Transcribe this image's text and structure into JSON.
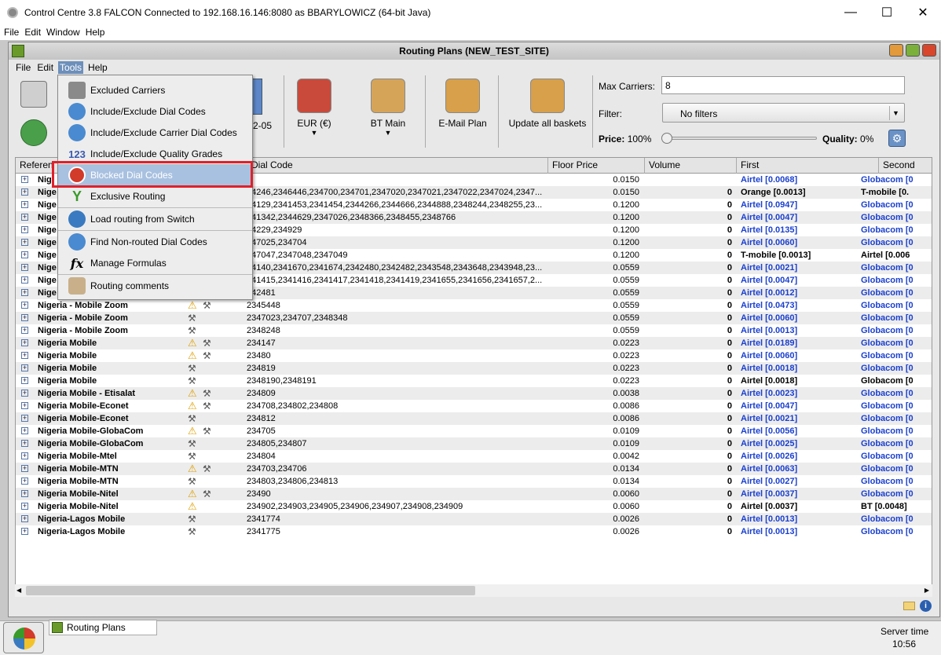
{
  "window": {
    "title": "Control Centre 3.8 FALCON Connected to 192.168.16.146:8080 as BBARYLOWICZ (64-bit Java)"
  },
  "top_menu": [
    "File",
    "Edit",
    "Window",
    "Help"
  ],
  "frame": {
    "title": "Routing Plans (NEW_TEST_SITE)"
  },
  "frame_menu": [
    "File",
    "Edit",
    "Tools",
    "Help"
  ],
  "toolbar": {
    "date_suffix": "2-05",
    "currency": "EUR (€)",
    "bt_main": "BT Main",
    "email_plan": "E-Mail Plan",
    "update_baskets": "Update all baskets"
  },
  "filters": {
    "max_carriers_label": "Max Carriers:",
    "max_carriers_value": "8",
    "filter_label": "Filter:",
    "filter_value": "No filters",
    "price_label": "Price:",
    "price_value": "100%",
    "quality_label": "Quality:",
    "quality_value": "0%",
    "slider_level": 0
  },
  "columns": [
    "Referen",
    "Dial Code",
    "Floor Price",
    "Volume",
    "First",
    "Second"
  ],
  "rows": [
    {
      "ref": "Nig",
      "code": "4",
      "price": "0.0150",
      "vol": "",
      "first": "Airtel [0.0068]",
      "first_blue": true,
      "second": "Globacom [0",
      "second_blue": true
    },
    {
      "ref": "Nige",
      "code": "34246,2346446,234700,234701,2347020,2347021,2347022,2347024,2347...",
      "price": "0.0150",
      "vol": "0",
      "first": "Orange [0.0013]",
      "first_blue": false,
      "second": "T-mobile [0.",
      "second_blue": false
    },
    {
      "ref": "Nige",
      "code": "34129,2341453,2341454,2344266,2344666,2344888,2348244,2348255,23...",
      "price": "0.1200",
      "vol": "0",
      "first": "Airtel [0.0947]",
      "first_blue": true,
      "second": "Globacom [0",
      "second_blue": true
    },
    {
      "ref": "Nige",
      "code": "341342,2344629,2347026,2348366,2348455,2348766",
      "price": "0.1200",
      "vol": "0",
      "first": "Airtel [0.0047]",
      "first_blue": true,
      "second": "Globacom [0",
      "second_blue": true
    },
    {
      "ref": "Nige",
      "code": "34229,234929",
      "price": "0.1200",
      "vol": "0",
      "first": "Airtel [0.0135]",
      "first_blue": true,
      "second": "Globacom [0",
      "second_blue": true
    },
    {
      "ref": "Nige",
      "code": "347025,234704",
      "price": "0.1200",
      "vol": "0",
      "first": "Airtel [0.0060]",
      "first_blue": true,
      "second": "Globacom [0",
      "second_blue": true
    },
    {
      "ref": "Nige",
      "code": "347047,2347048,2347049",
      "price": "0.1200",
      "vol": "0",
      "first": "T-mobile [0.0013]",
      "first_blue": false,
      "second": "Airtel [0.006",
      "second_blue": false
    },
    {
      "ref": "Nige",
      "code": "34140,2341670,2341674,2342480,2342482,2343548,2343648,2343948,23...",
      "price": "0.0559",
      "vol": "0",
      "first": "Airtel [0.0021]",
      "first_blue": true,
      "second": "Globacom [0",
      "second_blue": true
    },
    {
      "ref": "Nige",
      "code": "341415,2341416,2341417,2341418,2341419,2341655,2341656,2341657,2...",
      "price": "0.0559",
      "vol": "0",
      "first": "Airtel [0.0047]",
      "first_blue": true,
      "second": "Globacom [0",
      "second_blue": true
    },
    {
      "ref": "Nige",
      "code": "342481",
      "price": "0.0559",
      "vol": "0",
      "first": "Airtel [0.0012]",
      "first_blue": true,
      "second": "Globacom [0",
      "second_blue": true
    },
    {
      "ref": "Nigeria - Mobile Zoom",
      "code": "2345448",
      "price": "0.0559",
      "vol": "0",
      "first": "Airtel [0.0473]",
      "first_blue": true,
      "second": "Globacom [0",
      "second_blue": true,
      "warn": true
    },
    {
      "ref": "Nigeria - Mobile Zoom",
      "code": "2347023,234707,2348348",
      "price": "0.0559",
      "vol": "0",
      "first": "Airtel [0.0060]",
      "first_blue": true,
      "second": "Globacom [0",
      "second_blue": true
    },
    {
      "ref": "Nigeria - Mobile Zoom",
      "code": "2348248",
      "price": "0.0559",
      "vol": "0",
      "first": "Airtel [0.0013]",
      "first_blue": true,
      "second": "Globacom [0",
      "second_blue": true
    },
    {
      "ref": "Nigeria Mobile",
      "code": "234147",
      "price": "0.0223",
      "vol": "0",
      "first": "Airtel [0.0189]",
      "first_blue": true,
      "second": "Globacom [0",
      "second_blue": true,
      "warn": true
    },
    {
      "ref": "Nigeria Mobile",
      "code": "23480",
      "price": "0.0223",
      "vol": "0",
      "first": "Airtel [0.0060]",
      "first_blue": true,
      "second": "Globacom [0",
      "second_blue": true,
      "warn": true
    },
    {
      "ref": "Nigeria Mobile",
      "code": "234819",
      "price": "0.0223",
      "vol": "0",
      "first": "Airtel [0.0018]",
      "first_blue": true,
      "second": "Globacom [0",
      "second_blue": true
    },
    {
      "ref": "Nigeria Mobile",
      "code": "2348190,2348191",
      "price": "0.0223",
      "vol": "0",
      "first": "Airtel [0.0018]",
      "first_blue": false,
      "second": "Globacom [0",
      "second_blue": false
    },
    {
      "ref": "Nigeria Mobile - Etisalat",
      "code": "234809",
      "price": "0.0038",
      "vol": "0",
      "first": "Airtel [0.0023]",
      "first_blue": true,
      "second": "Globacom [0",
      "second_blue": true,
      "warn": true
    },
    {
      "ref": "Nigeria Mobile-Econet",
      "code": "234708,234802,234808",
      "price": "0.0086",
      "vol": "0",
      "first": "Airtel [0.0047]",
      "first_blue": true,
      "second": "Globacom [0",
      "second_blue": true,
      "warn": true
    },
    {
      "ref": "Nigeria Mobile-Econet",
      "code": "234812",
      "price": "0.0086",
      "vol": "0",
      "first": "Airtel [0.0021]",
      "first_blue": true,
      "second": "Globacom [0",
      "second_blue": true
    },
    {
      "ref": "Nigeria Mobile-GlobaCom",
      "code": "234705",
      "price": "0.0109",
      "vol": "0",
      "first": "Airtel [0.0056]",
      "first_blue": true,
      "second": "Globacom [0",
      "second_blue": true,
      "warn": true
    },
    {
      "ref": "Nigeria Mobile-GlobaCom",
      "code": "234805,234807",
      "price": "0.0109",
      "vol": "0",
      "first": "Airtel [0.0025]",
      "first_blue": true,
      "second": "Globacom [0",
      "second_blue": true
    },
    {
      "ref": "Nigeria Mobile-Mtel",
      "code": "234804",
      "price": "0.0042",
      "vol": "0",
      "first": "Airtel [0.0026]",
      "first_blue": true,
      "second": "Globacom [0",
      "second_blue": true
    },
    {
      "ref": "Nigeria Mobile-MTN",
      "code": "234703,234706",
      "price": "0.0134",
      "vol": "0",
      "first": "Airtel [0.0063]",
      "first_blue": true,
      "second": "Globacom [0",
      "second_blue": true,
      "warn": true
    },
    {
      "ref": "Nigeria Mobile-MTN",
      "code": "234803,234806,234813",
      "price": "0.0134",
      "vol": "0",
      "first": "Airtel [0.0027]",
      "first_blue": true,
      "second": "Globacom [0",
      "second_blue": true
    },
    {
      "ref": "Nigeria Mobile-Nitel",
      "code": "23490",
      "price": "0.0060",
      "vol": "0",
      "first": "Airtel [0.0037]",
      "first_blue": true,
      "second": "Globacom [0",
      "second_blue": true,
      "warn": true
    },
    {
      "ref": "Nigeria Mobile-Nitel",
      "code": "234902,234903,234905,234906,234907,234908,234909",
      "price": "0.0060",
      "vol": "0",
      "first": "Airtel [0.0037]",
      "first_blue": false,
      "second": "BT [0.0048]",
      "second_blue": false,
      "warn": true,
      "nohammer": true
    },
    {
      "ref": "Nigeria-Lagos Mobile",
      "code": "2341774",
      "price": "0.0026",
      "vol": "0",
      "first": "Airtel [0.0013]",
      "first_blue": true,
      "second": "Globacom [0",
      "second_blue": true
    },
    {
      "ref": "Nigeria-Lagos Mobile",
      "code": "2341775",
      "price": "0.0026",
      "vol": "0",
      "first": "Airtel [0.0013]",
      "first_blue": true,
      "second": "Globacom [0",
      "second_blue": true
    }
  ],
  "tools_menu": [
    {
      "label": "Excluded Carriers",
      "icon": "excluded-carriers-icon"
    },
    {
      "label": "Include/Exclude Dial Codes",
      "icon": "globe-icon"
    },
    {
      "label": "Include/Exclude Carrier Dial Codes",
      "icon": "globe-carrier-icon"
    },
    {
      "label": "Include/Exclude Quality Grades",
      "icon": "quality-grades-icon"
    },
    {
      "label": "Blocked Dial Codes",
      "icon": "blocked-icon"
    },
    {
      "label": "Exclusive Routing",
      "icon": "exclusive-routing-icon"
    },
    {
      "label": "Load routing from Switch",
      "icon": "load-routing-icon"
    },
    {
      "label": "Find Non-routed Dial Codes",
      "icon": "find-icon"
    },
    {
      "label": "Manage Formulas",
      "icon": "formula-icon"
    },
    {
      "label": "Routing comments",
      "icon": "comment-icon"
    }
  ],
  "taskbar": {
    "routing_plans": "Routing Plans"
  },
  "status": {
    "server_time_label": "Server time",
    "server_time": "10:56"
  },
  "colors": {
    "highlight_box": "#e0202a",
    "link_blue": "#1a3fcf"
  }
}
